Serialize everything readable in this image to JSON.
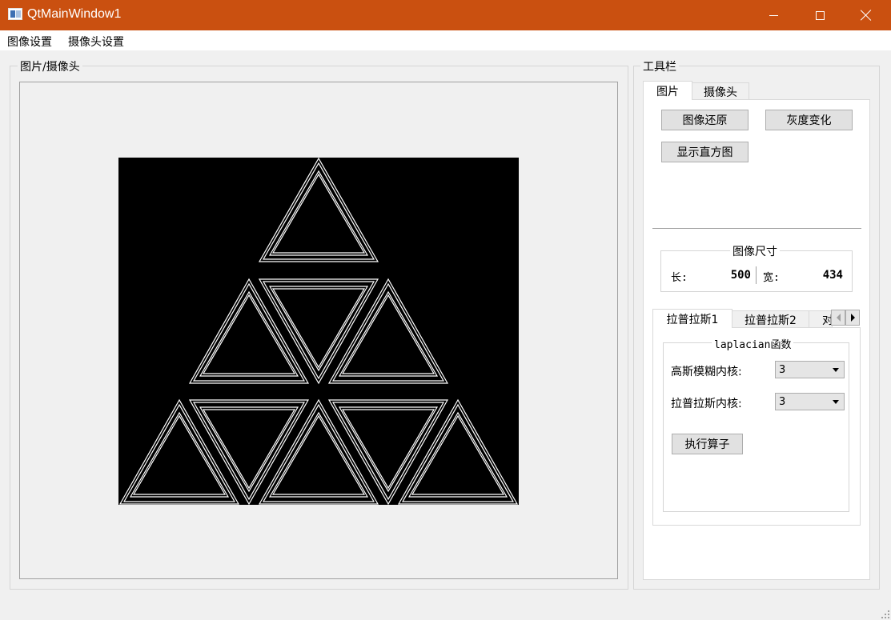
{
  "window": {
    "title": "QtMainWindow1"
  },
  "menu": {
    "items": [
      "图像设置",
      "摄像头设置"
    ]
  },
  "left_group": {
    "title": "图片/摄像头"
  },
  "toolbox": {
    "title": "工具栏",
    "tabs": [
      "图片",
      "摄像头"
    ],
    "buttons": {
      "restore": "图像还原",
      "gray": "灰度变化",
      "histogram": "显示直方图"
    },
    "size_group": {
      "title": "图像尺寸",
      "length_label": "长:",
      "length_value": "500",
      "width_label": "宽:",
      "width_value": "434"
    },
    "op_tabs": [
      "拉普拉斯1",
      "拉普拉斯2",
      "对"
    ],
    "laplacian_group": {
      "title": "laplacian函数",
      "gauss_label": "高斯模糊内核:",
      "gauss_value": "3",
      "laplace_label": "拉普拉斯内核:",
      "laplace_value": "3",
      "run_button": "执行算子"
    }
  },
  "icons": {
    "app": "window-icon",
    "minimize": "minimize-icon",
    "maximize": "maximize-icon",
    "close": "close-icon",
    "scroll_left": "arrow-left-icon",
    "scroll_right": "arrow-right-icon"
  },
  "colors": {
    "titlebar": "#ca5010",
    "background": "#f0f0f0",
    "image_bg": "#000000",
    "image_lines": "#ffffff"
  }
}
